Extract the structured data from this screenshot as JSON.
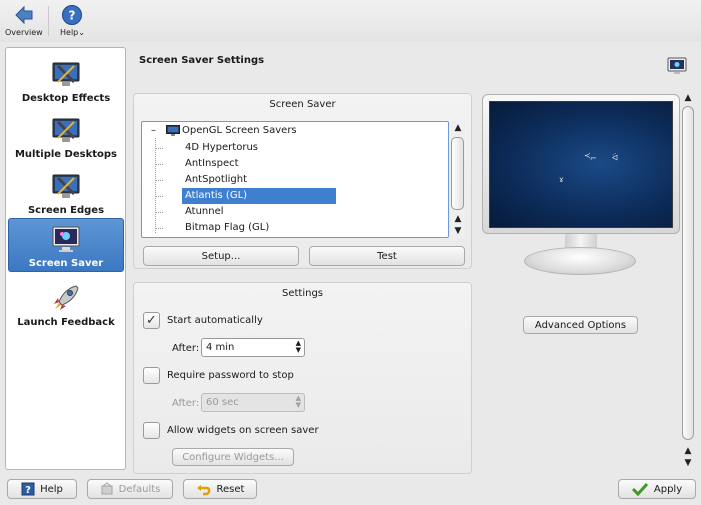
{
  "toolbar": {
    "overview_label": "Overview",
    "help_label": "Help"
  },
  "sidebar": {
    "items": [
      {
        "label": "Desktop Effects",
        "icon": "monitor-wrench-icon"
      },
      {
        "label": "Multiple Desktops",
        "icon": "monitor-wrench-icon"
      },
      {
        "label": "Screen Edges",
        "icon": "monitor-wrench-icon"
      },
      {
        "label": "Screen Saver",
        "icon": "monitor-icon",
        "selected": true
      },
      {
        "label": "Launch Feedback",
        "icon": "rocket-icon"
      }
    ]
  },
  "header": {
    "title": "Screen Saver Settings"
  },
  "screensaver_group": {
    "title": "Screen Saver",
    "tree": {
      "category": "OpenGL Screen Savers",
      "expander": "–",
      "items": [
        {
          "label": "4D Hypertorus"
        },
        {
          "label": "AntInspect"
        },
        {
          "label": "AntSpotlight"
        },
        {
          "label": "Atlantis (GL)",
          "selected": true
        },
        {
          "label": "Atunnel"
        },
        {
          "label": "Bitmap Flag (GL)"
        }
      ]
    },
    "setup_button": "Setup...",
    "test_button": "Test"
  },
  "settings_group": {
    "title": "Settings",
    "start_automatically": {
      "label": "Start automatically",
      "checked": true
    },
    "start_after_label": "After:",
    "start_after_value": "4 min",
    "require_password": {
      "label": "Require password to stop",
      "checked": false
    },
    "password_after_label": "After:",
    "password_after_value": "60 sec",
    "allow_widgets": {
      "label": "Allow widgets on screen saver",
      "checked": false
    },
    "configure_widgets_button": "Configure Widgets..."
  },
  "preview": {
    "advanced_options_button": "Advanced Options"
  },
  "bottom": {
    "help_button": "Help",
    "defaults_button": "Defaults",
    "reset_button": "Reset",
    "apply_button": "Apply"
  },
  "colors": {
    "selection": "#3f7fd0",
    "sidebar_selected": "#4a86cc",
    "preview_screen": "#0c2a57"
  }
}
